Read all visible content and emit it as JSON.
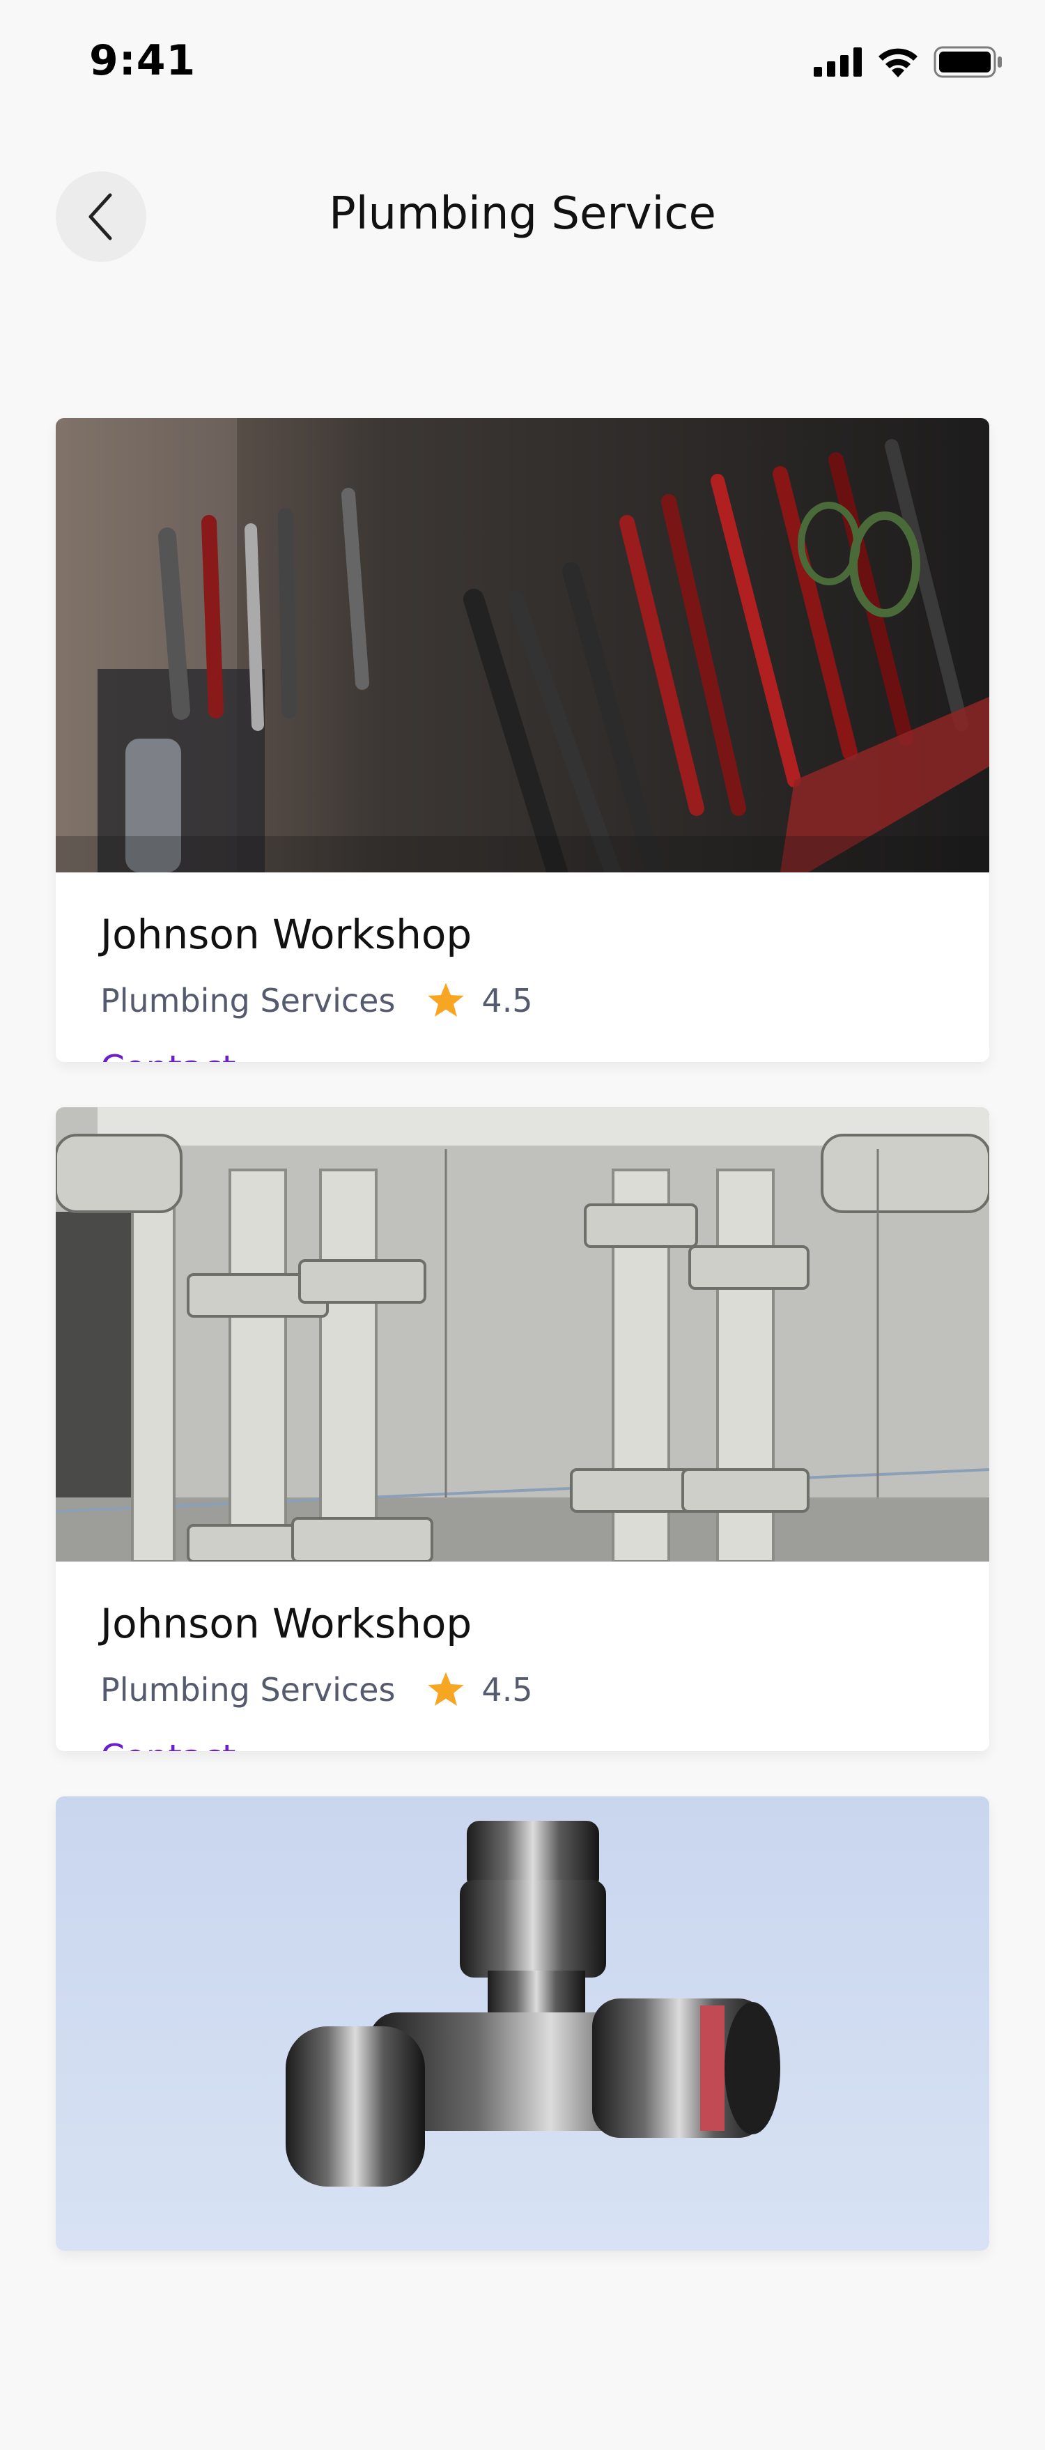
{
  "status_bar": {
    "time": "9:41",
    "icons": [
      "signal-icon",
      "wifi-icon",
      "battery-icon"
    ]
  },
  "header": {
    "title": "Plumbing Service",
    "back_icon": "chevron-left-icon"
  },
  "colors": {
    "link": "#6b1fc9",
    "star": "#f6a623",
    "meta_text": "#555a6e"
  },
  "cards": [
    {
      "image": "tools-photo",
      "title": "Johnson Workshop",
      "category": "Plumbing Services",
      "rating": "4.5",
      "contact_label": "Contact"
    },
    {
      "image": "pipes-photo",
      "title": "Johnson Workshop",
      "category": "Plumbing Services",
      "rating": "4.5",
      "contact_label": "Contact"
    },
    {
      "image": "valve-photo"
    }
  ]
}
